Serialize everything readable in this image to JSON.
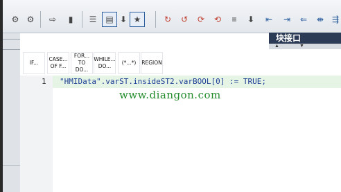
{
  "toolbar": {
    "icons": [
      {
        "name": "insert-network-icon",
        "glyph": "⚙"
      },
      {
        "name": "delete-network-icon",
        "glyph": "⚙"
      },
      {
        "name": "goto-call-icon",
        "glyph": "⇨"
      },
      {
        "name": "monitor-icon",
        "glyph": "▮"
      },
      {
        "name": "list-icon",
        "glyph": "☰"
      },
      {
        "name": "absolute-operands-icon",
        "glyph": "▤"
      },
      {
        "name": "save-icon",
        "glyph": "⬇"
      },
      {
        "name": "favorites-icon",
        "glyph": "★"
      },
      {
        "name": "bookmark-set-icon",
        "glyph": "↻"
      },
      {
        "name": "bookmark-clear-icon",
        "glyph": "↺"
      },
      {
        "name": "bookmark-next-icon",
        "glyph": "⟳"
      },
      {
        "name": "bookmark-prev-icon",
        "glyph": "⟲"
      },
      {
        "name": "comment-icon",
        "glyph": "≡"
      },
      {
        "name": "download-icon",
        "glyph": "⬇"
      },
      {
        "name": "indent-left-icon",
        "glyph": "⇤"
      },
      {
        "name": "indent-right-icon",
        "glyph": "⇥"
      },
      {
        "name": "outdent-icon",
        "glyph": "⇐"
      },
      {
        "name": "align-icon",
        "glyph": "⇼"
      },
      {
        "name": "format-icon",
        "glyph": "⇶"
      }
    ]
  },
  "block_interface": {
    "label": "块接口"
  },
  "instructions": [
    {
      "line1": "IF...",
      "line2": ""
    },
    {
      "line1": "CASE...",
      "line2": "OF F..."
    },
    {
      "line1": "FOR...",
      "line2": "TO DO..."
    },
    {
      "line1": "WHILE...",
      "line2": "DO..."
    },
    {
      "line1": "(*...*)",
      "line2": ""
    },
    {
      "line1": "REGION",
      "line2": ""
    }
  ],
  "editor": {
    "line_number": "1",
    "code": "\"HMIData\".varST.insideST2.varBOOL[0] := TRUE;",
    "watermark": "www.diangon.com"
  },
  "colors": {
    "code_text": "#1c3e96",
    "line_highlight": "#e6f4e6",
    "watermark": "#208a2a",
    "header_bg": "#2b3a55"
  }
}
